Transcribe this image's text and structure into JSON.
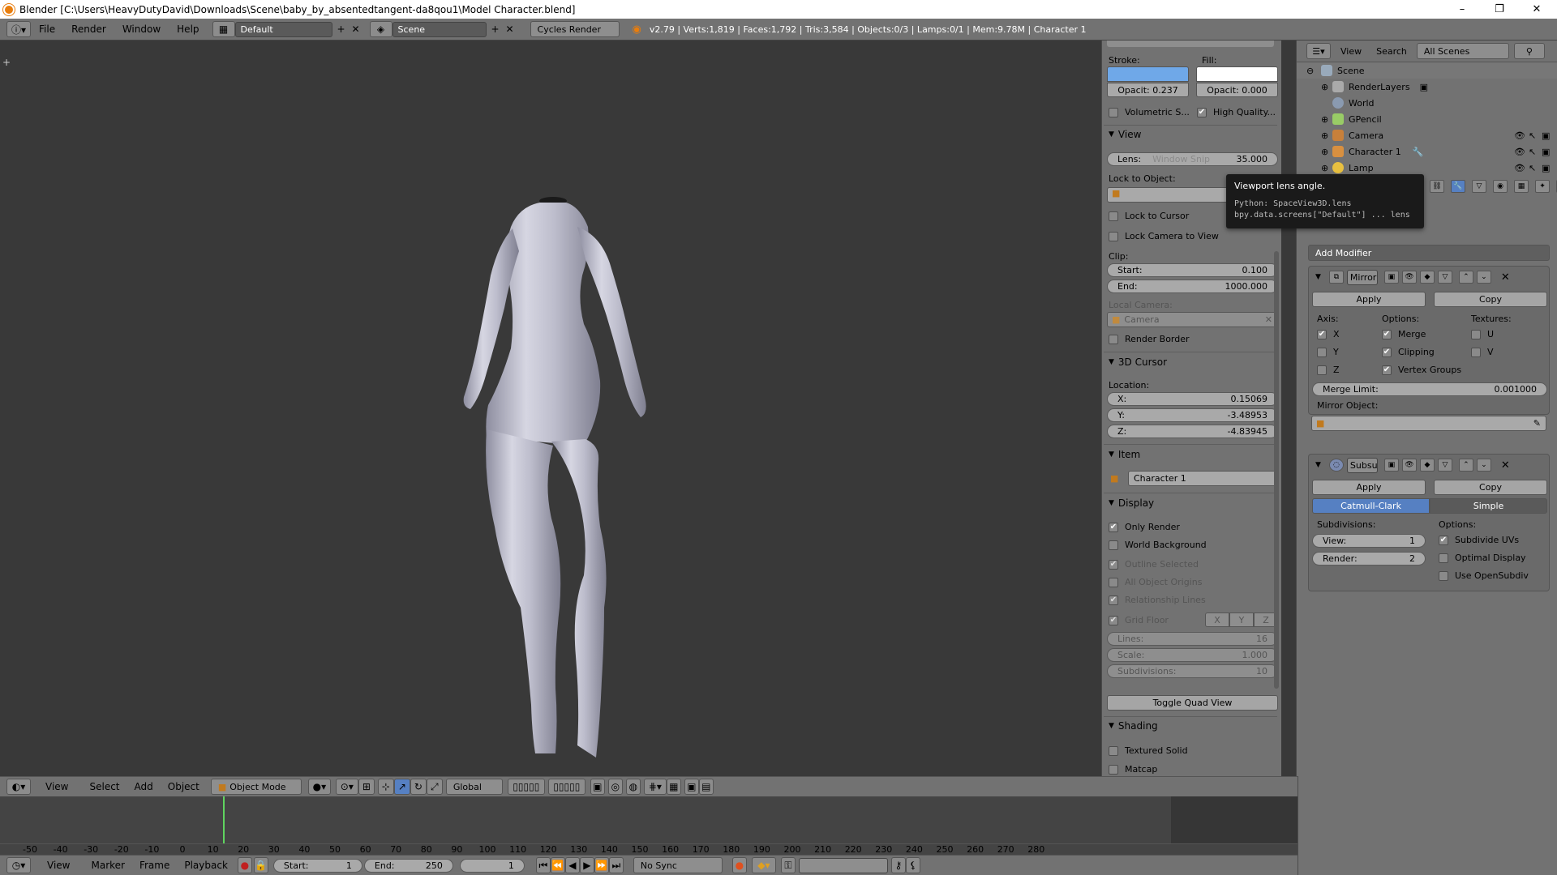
{
  "window": {
    "title": "Blender [C:\\Users\\HeavyDutyDavid\\Downloads\\Scene\\baby_by_absentedtangent-da8qou1\\Model Character.blend]",
    "controls": [
      "–",
      "❐",
      "✕"
    ]
  },
  "topbar": {
    "menus": [
      "File",
      "Render",
      "Window",
      "Help"
    ],
    "layout": "Default",
    "scene": "Scene",
    "engine": "Cycles Render",
    "status": "v2.79 | Verts:1,819 | Faces:1,792 | Tris:3,584 | Objects:0/3 | Lamps:0/1 | Mem:9.78M | Character 1"
  },
  "npanel": {
    "stroke_label": "Stroke:",
    "fill_label": "Fill:",
    "stroke_opacity": "Opacit: 0.237",
    "fill_opacity": "Opacit: 0.000",
    "volumetric": "Volumetric S...",
    "high_quality": "High Quality...",
    "view_header": "View",
    "lens_label": "Lens:",
    "lens_hint": "Window Snip",
    "lens_value": "35.000",
    "lock_to_object": "Lock to Object:",
    "lock_to_cursor": "Lock to Cursor",
    "lock_camera": "Lock Camera to View",
    "clip_label": "Clip:",
    "clip_start_label": "Start:",
    "clip_start": "0.100",
    "clip_end_label": "End:",
    "clip_end": "1000.000",
    "local_camera": "Local Camera:",
    "camera_field": "Camera",
    "render_border": "Render Border",
    "cursor_header": "3D Cursor",
    "location_label": "Location:",
    "x_label": "X:",
    "x_value": "0.15069",
    "y_label": "Y:",
    "y_value": "-3.48953",
    "z_label": "Z:",
    "z_value": "-4.83945",
    "item_header": "Item",
    "item_name": "Character 1",
    "display_header": "Display",
    "only_render": "Only Render",
    "world_background": "World Background",
    "outline_selected": "Outline Selected",
    "all_object_origins": "All Object Origins",
    "relationship_lines": "Relationship Lines",
    "grid_floor": "Grid Floor",
    "grid_x": "X",
    "grid_y": "Y",
    "grid_z": "Z",
    "lines_label": "Lines:",
    "lines_value": "16",
    "scale_label": "Scale:",
    "scale_value": "1.000",
    "subdiv_label": "Subdivisions:",
    "subdiv_value": "10",
    "toggle_quad": "Toggle Quad View",
    "shading_header": "Shading",
    "textured_solid": "Textured Solid",
    "matcap": "Matcap"
  },
  "tooltip": {
    "title": "Viewport lens angle.",
    "python1": "Python: SpaceView3D.lens",
    "python2": "bpy.data.screens[\"Default\"] ... lens"
  },
  "outliner": {
    "view": "View",
    "search": "Search",
    "filter": "All Scenes",
    "items": [
      "Scene",
      "RenderLayers",
      "World",
      "GPencil",
      "Camera",
      "Character 1",
      "Lamp"
    ]
  },
  "properties": {
    "add_modifier": "Add Modifier",
    "mirror": {
      "name": "Mirror",
      "apply": "Apply",
      "copy": "Copy",
      "axis": "Axis:",
      "options": "Options:",
      "textures": "Textures:",
      "x": "X",
      "y": "Y",
      "z": "Z",
      "merge": "Merge",
      "clipping": "Clipping",
      "vertex_groups": "Vertex Groups",
      "u": "U",
      "v": "V",
      "merge_limit_label": "Merge Limit:",
      "merge_limit": "0.001000",
      "mirror_object": "Mirror Object:"
    },
    "subsurf": {
      "name": "Subsu",
      "apply": "Apply",
      "copy": "Copy",
      "catmull": "Catmull-Clark",
      "simple": "Simple",
      "subdivisions": "Subdivisions:",
      "options": "Options:",
      "view_label": "View:",
      "view_value": "1",
      "render_label": "Render:",
      "render_value": "2",
      "subdivide_uvs": "Subdivide UVs",
      "optimal_display": "Optimal Display",
      "use_opensubdiv": "Use OpenSubdiv"
    }
  },
  "viewport_header": {
    "menus": [
      "View",
      "Select",
      "Add",
      "Object"
    ],
    "mode": "Object Mode",
    "orientation": "Global"
  },
  "timeline": {
    "ticks": [
      "-50",
      "-40",
      "-30",
      "-20",
      "-10",
      "0",
      "10",
      "20",
      "30",
      "40",
      "50",
      "60",
      "70",
      "80",
      "90",
      "100",
      "110",
      "120",
      "130",
      "140",
      "150",
      "160",
      "170",
      "180",
      "190",
      "200",
      "210",
      "220",
      "230",
      "240",
      "250",
      "260",
      "270",
      "280"
    ],
    "menus": [
      "View",
      "Marker",
      "Frame",
      "Playback"
    ],
    "start_label": "Start:",
    "start": "1",
    "end_label": "End:",
    "end": "250",
    "current": "1",
    "sync": "No Sync"
  },
  "colors": {
    "panel_bg": "#727272",
    "viewport_bg": "#393939",
    "selected_blue": "#5680c2",
    "stroke_color": "#6fa8e8"
  }
}
